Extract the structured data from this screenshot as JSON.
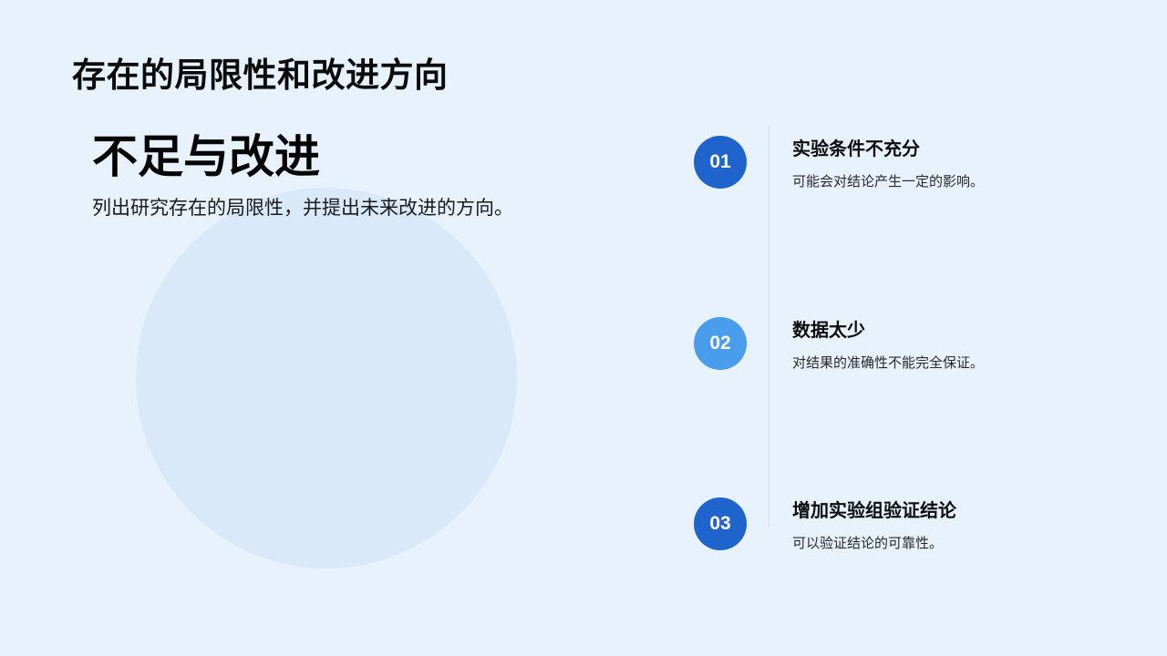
{
  "page": {
    "title": "存在的局限性和改进方向"
  },
  "hero": {
    "title": "不足与改进",
    "description": "列出研究存在的局限性，并提出未来改进的方向。"
  },
  "items": [
    {
      "number": "01",
      "heading": "实验条件不充分",
      "text": "可能会对结论产生一定的影响。",
      "badge_color": "#1f64cc"
    },
    {
      "number": "02",
      "heading": "数据太少",
      "text": "对结果的准确性不能完全保证。",
      "badge_color": "#4a9cec"
    },
    {
      "number": "03",
      "heading": "增加实验组验证结论",
      "text": "可以验证结论的可靠性。",
      "badge_color": "#1f64cc"
    }
  ],
  "colors": {
    "background": "#e8f2fc",
    "decorative_circle": "#d9e9fa",
    "timeline_line": "#cfdcea"
  }
}
